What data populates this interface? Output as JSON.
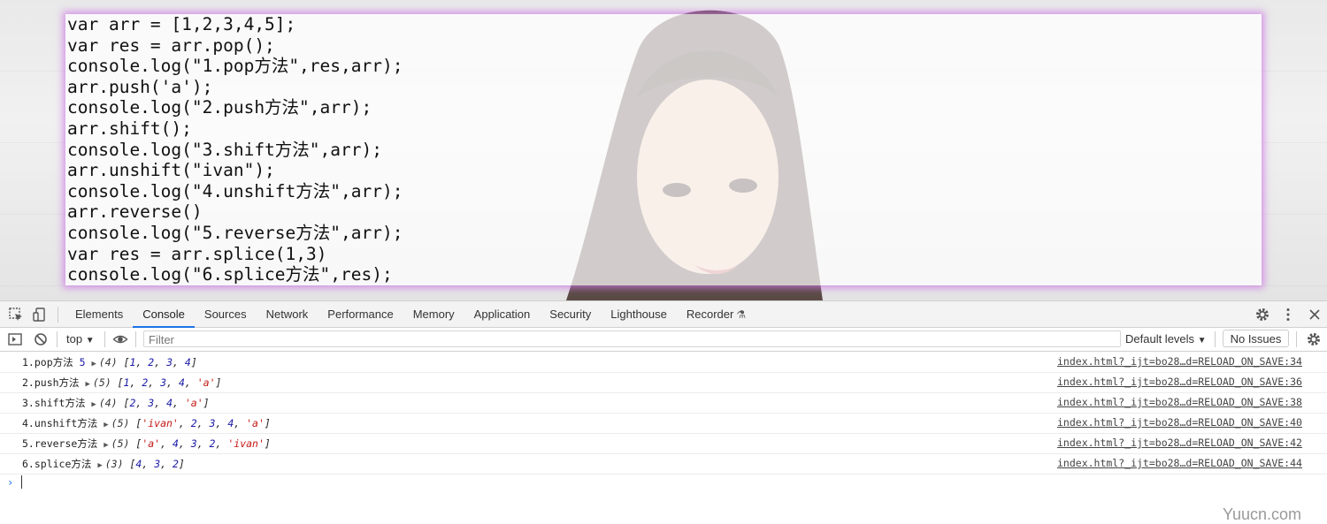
{
  "code_lines": [
    "var arr = [1,2,3,4,5];",
    "var res = arr.pop();",
    "console.log(\"1.pop方法\",res,arr);",
    "arr.push('a');",
    "console.log(\"2.push方法\",arr);",
    "arr.shift();",
    "console.log(\"3.shift方法\",arr);",
    "arr.unshift(\"ivan\");",
    "console.log(\"4.unshift方法\",arr);",
    "arr.reverse()",
    "console.log(\"5.reverse方法\",arr);",
    "var res = arr.splice(1,3)",
    "console.log(\"6.splice方法\",res);"
  ],
  "devtools": {
    "tabs": [
      "Elements",
      "Console",
      "Sources",
      "Network",
      "Performance",
      "Memory",
      "Application",
      "Security",
      "Lighthouse",
      "Recorder"
    ],
    "active_tab": "Console",
    "context": "top",
    "filter_placeholder": "Filter",
    "levels_label": "Default levels",
    "issues_label": "No Issues",
    "accent_color": "#1a73e8"
  },
  "console_rows": [
    {
      "label": "1.pop方法",
      "extra": "5",
      "count": "(4)",
      "items": [
        {
          "t": "num",
          "v": "1"
        },
        {
          "t": "num",
          "v": "2"
        },
        {
          "t": "num",
          "v": "3"
        },
        {
          "t": "num",
          "v": "4"
        }
      ],
      "source": "index.html?_ijt=bo28…d=RELOAD_ON_SAVE:34"
    },
    {
      "label": "2.push方法",
      "extra": "",
      "count": "(5)",
      "items": [
        {
          "t": "num",
          "v": "1"
        },
        {
          "t": "num",
          "v": "2"
        },
        {
          "t": "num",
          "v": "3"
        },
        {
          "t": "num",
          "v": "4"
        },
        {
          "t": "str",
          "v": "'a'"
        }
      ],
      "source": "index.html?_ijt=bo28…d=RELOAD_ON_SAVE:36"
    },
    {
      "label": "3.shift方法",
      "extra": "",
      "count": "(4)",
      "items": [
        {
          "t": "num",
          "v": "2"
        },
        {
          "t": "num",
          "v": "3"
        },
        {
          "t": "num",
          "v": "4"
        },
        {
          "t": "str",
          "v": "'a'"
        }
      ],
      "source": "index.html?_ijt=bo28…d=RELOAD_ON_SAVE:38"
    },
    {
      "label": "4.unshift方法",
      "extra": "",
      "count": "(5)",
      "items": [
        {
          "t": "str",
          "v": "'ivan'"
        },
        {
          "t": "num",
          "v": "2"
        },
        {
          "t": "num",
          "v": "3"
        },
        {
          "t": "num",
          "v": "4"
        },
        {
          "t": "str",
          "v": "'a'"
        }
      ],
      "source": "index.html?_ijt=bo28…d=RELOAD_ON_SAVE:40"
    },
    {
      "label": "5.reverse方法",
      "extra": "",
      "count": "(5)",
      "items": [
        {
          "t": "str",
          "v": "'a'"
        },
        {
          "t": "num",
          "v": "4"
        },
        {
          "t": "num",
          "v": "3"
        },
        {
          "t": "num",
          "v": "2"
        },
        {
          "t": "str",
          "v": "'ivan'"
        }
      ],
      "source": "index.html?_ijt=bo28…d=RELOAD_ON_SAVE:42"
    },
    {
      "label": "6.splice方法",
      "extra": "",
      "count": "(3)",
      "items": [
        {
          "t": "num",
          "v": "4"
        },
        {
          "t": "num",
          "v": "3"
        },
        {
          "t": "num",
          "v": "2"
        }
      ],
      "source": "index.html?_ijt=bo28…d=RELOAD_ON_SAVE:44"
    }
  ],
  "watermark": "Yuucn.com"
}
